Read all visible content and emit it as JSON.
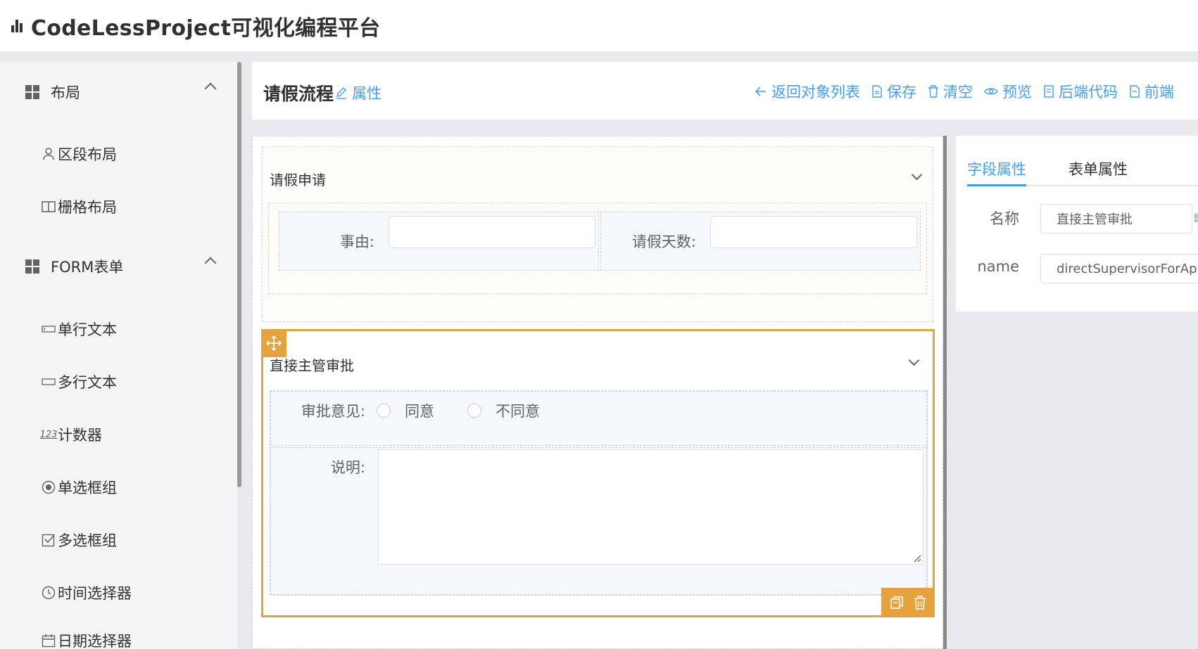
{
  "app": {
    "title": "CodeLessProject可视化编程平台"
  },
  "sidebar": {
    "groups": [
      {
        "label": "布局",
        "items": [
          "区段布局",
          "栅格布局"
        ]
      },
      {
        "label": "FORM表单",
        "items": [
          "单行文本",
          "多行文本",
          "计数器",
          "单选框组",
          "多选框组",
          "时间选择器",
          "日期选择器"
        ]
      }
    ],
    "counter_icon_text": "123"
  },
  "header": {
    "form_title": "请假流程",
    "attr_link": "属性",
    "toolbar": {
      "back": "返回对象列表",
      "save": "保存",
      "clear": "清空",
      "preview": "预览",
      "backend_code": "后端代码",
      "frontend_code": "前端"
    }
  },
  "canvas": {
    "section1": {
      "title": "请假申请",
      "fields": [
        {
          "label": "事由:",
          "value": ""
        },
        {
          "label": "请假天数:",
          "value": ""
        }
      ]
    },
    "section2": {
      "title": "直接主管审批",
      "approval": {
        "label": "审批意见:",
        "options": [
          "同意",
          "不同意"
        ]
      },
      "remark": {
        "label": "说明:",
        "value": ""
      }
    }
  },
  "properties": {
    "tabs": [
      "字段属性",
      "表单属性"
    ],
    "active_tab": 0,
    "fields": [
      {
        "label": "名称",
        "value": "直接主管审批"
      },
      {
        "label": "name",
        "value": "directSupervisorForAppro"
      }
    ]
  },
  "colors": {
    "accent": "#409eff",
    "selected": "#e6a23c"
  }
}
